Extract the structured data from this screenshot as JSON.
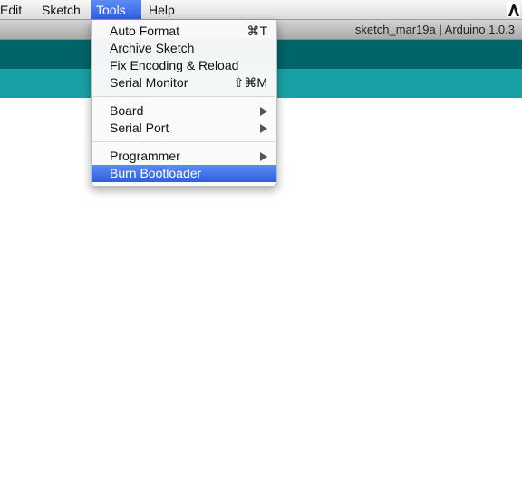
{
  "menubar": {
    "items": [
      {
        "label": "Edit"
      },
      {
        "label": "Sketch"
      },
      {
        "label": "Tools"
      },
      {
        "label": "Help"
      }
    ],
    "active_item": "Tools",
    "right_icon": "adobe-icon"
  },
  "window": {
    "title": "sketch_mar19a | Arduino 1.0.3"
  },
  "colors": {
    "toolbar": "#006468",
    "tabbar": "#17a1a5",
    "highlight": "#3d6ee6"
  },
  "tools_menu": {
    "auto_format": {
      "label": "Auto Format",
      "shortcut": "⌘T"
    },
    "archive_sketch": {
      "label": "Archive Sketch"
    },
    "fix_encoding": {
      "label": "Fix Encoding & Reload"
    },
    "serial_monitor": {
      "label": "Serial Monitor",
      "shortcut": "⇧⌘M"
    },
    "board": {
      "label": "Board",
      "submenu_icon": "chevron-right-icon"
    },
    "serial_port": {
      "label": "Serial Port",
      "submenu_icon": "chevron-right-icon"
    },
    "programmer": {
      "label": "Programmer",
      "submenu_icon": "chevron-right-icon"
    },
    "burn_bootloader": {
      "label": "Burn Bootloader",
      "highlighted": true
    }
  }
}
